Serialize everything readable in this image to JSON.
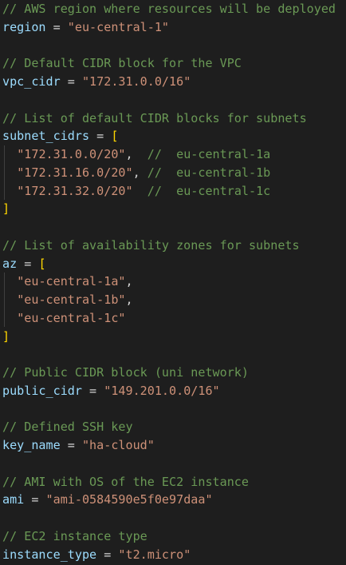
{
  "lines": [
    {
      "type": "comment",
      "text": "// AWS region where resources will be deployed"
    },
    {
      "type": "assign",
      "name": "region",
      "op": " = ",
      "value": "\"eu-central-1\""
    },
    {
      "type": "blank"
    },
    {
      "type": "comment",
      "text": "// Default CIDR block for the VPC"
    },
    {
      "type": "assign",
      "name": "vpc_cidr",
      "op": " = ",
      "value": "\"172.31.0.0/16\""
    },
    {
      "type": "blank"
    },
    {
      "type": "comment",
      "text": "// List of default CIDR blocks for subnets"
    },
    {
      "type": "list_open",
      "name": "subnet_cidrs",
      "op": " = ",
      "bracket": "["
    },
    {
      "type": "item",
      "indent": "  ",
      "value": "\"172.31.0.0/20\"",
      "sep": ",  ",
      "comment": "//  eu-central-1a"
    },
    {
      "type": "item",
      "indent": "  ",
      "value": "\"172.31.16.0/20\"",
      "sep": ", ",
      "comment": "//  eu-central-1b"
    },
    {
      "type": "item",
      "indent": "  ",
      "value": "\"172.31.32.0/20\"",
      "sep": "  ",
      "comment": "//  eu-central-1c"
    },
    {
      "type": "list_close",
      "bracket": "]"
    },
    {
      "type": "blank"
    },
    {
      "type": "comment",
      "text": "// List of availability zones for subnets"
    },
    {
      "type": "list_open",
      "name": "az",
      "op": " = ",
      "bracket": "["
    },
    {
      "type": "item",
      "indent": "  ",
      "value": "\"eu-central-1a\"",
      "sep": ",",
      "comment": ""
    },
    {
      "type": "item",
      "indent": "  ",
      "value": "\"eu-central-1b\"",
      "sep": ",",
      "comment": ""
    },
    {
      "type": "item",
      "indent": "  ",
      "value": "\"eu-central-1c\"",
      "sep": "",
      "comment": ""
    },
    {
      "type": "list_close",
      "bracket": "]"
    },
    {
      "type": "blank"
    },
    {
      "type": "comment",
      "text": "// Public CIDR block (uni network)"
    },
    {
      "type": "assign",
      "name": "public_cidr",
      "op": " = ",
      "value": "\"149.201.0.0/16\""
    },
    {
      "type": "blank"
    },
    {
      "type": "comment",
      "text": "// Defined SSH key"
    },
    {
      "type": "assign",
      "name": "key_name",
      "op": " = ",
      "value": "\"ha-cloud\""
    },
    {
      "type": "blank"
    },
    {
      "type": "comment",
      "text": "// AMI with OS of the EC2 instance"
    },
    {
      "type": "assign",
      "name": "ami",
      "op": " = ",
      "value": "\"ami-0584590e5f0e97daa\""
    },
    {
      "type": "blank"
    },
    {
      "type": "comment",
      "text": "// EC2 instance type"
    },
    {
      "type": "assign",
      "name": "instance_type",
      "op": " = ",
      "value": "\"t2.micro\""
    }
  ]
}
